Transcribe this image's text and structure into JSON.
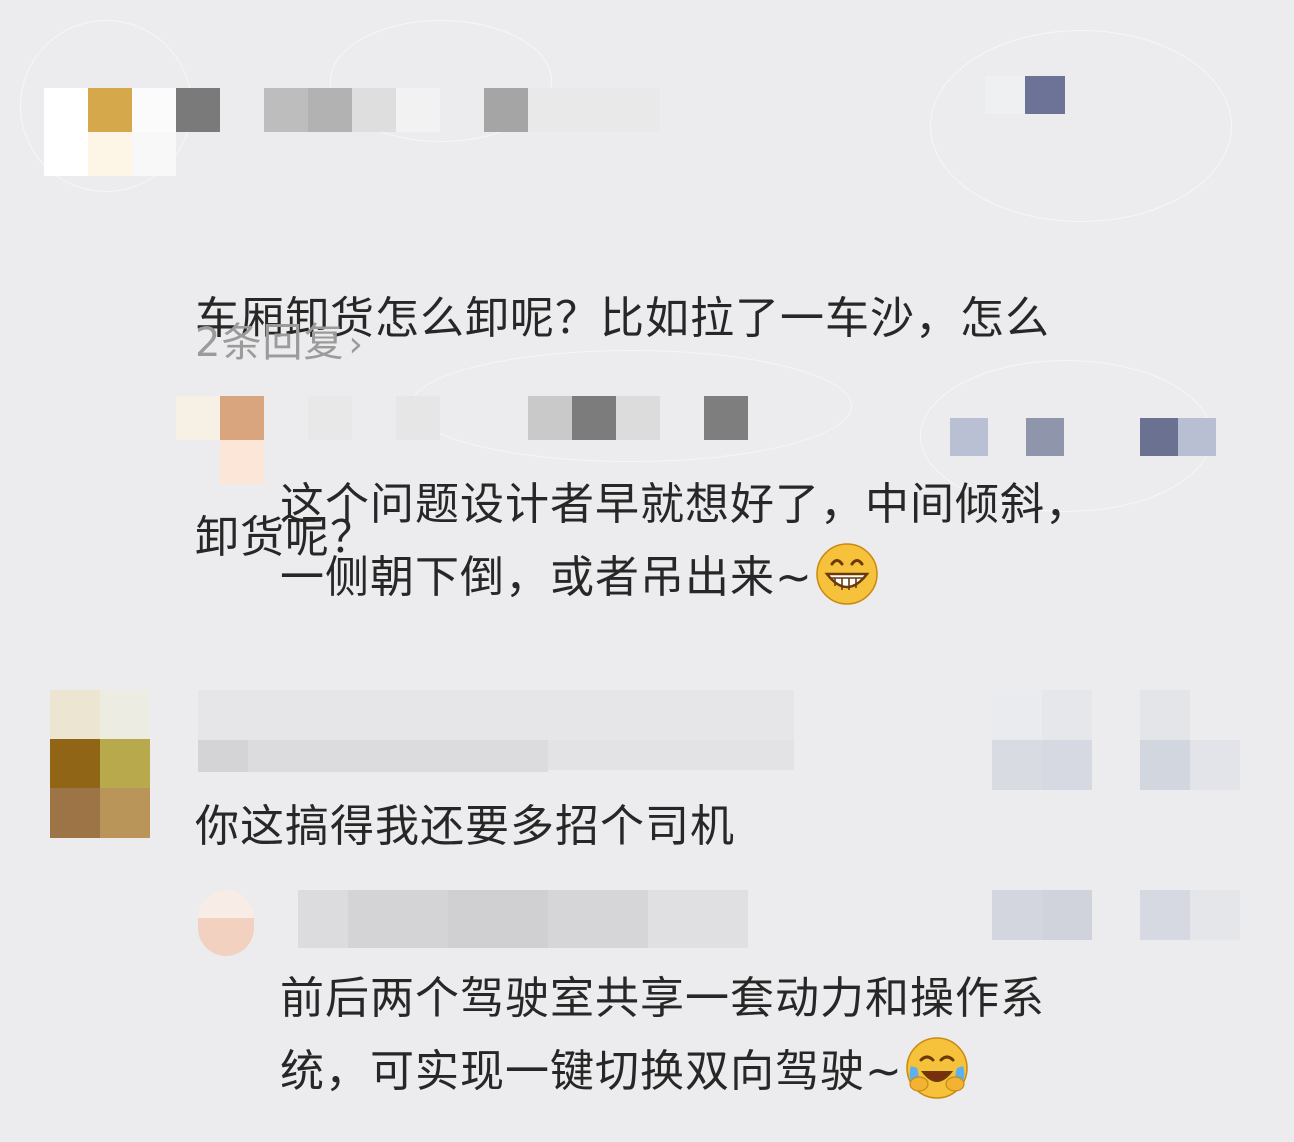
{
  "thread": {
    "comment_1": {
      "text_line_1": "车厢卸货怎么卸呢？比如拉了一车沙，怎么",
      "text_line_2": "卸货呢？",
      "reply_count_label": "2条回复",
      "reply": {
        "text_line_1": "这个问题设计者早就想好了，中间倾斜，",
        "text_line_2": "一侧朝下倒，或者吊出来~",
        "emoji": "grinning-face"
      }
    },
    "comment_2": {
      "text": "你这搞得我还要多招个司机",
      "reply": {
        "text_line_1": "前后两个驾驶室共享一套动力和操作系",
        "text_line_2": "统，可实现一键切换双向驾驶~",
        "emoji": "face-with-tears-of-joy"
      }
    }
  },
  "colors": {
    "background": "#ececee",
    "text": "#272727",
    "muted": "#9b9b9b",
    "emoji_yellow": "#f7c23b"
  }
}
